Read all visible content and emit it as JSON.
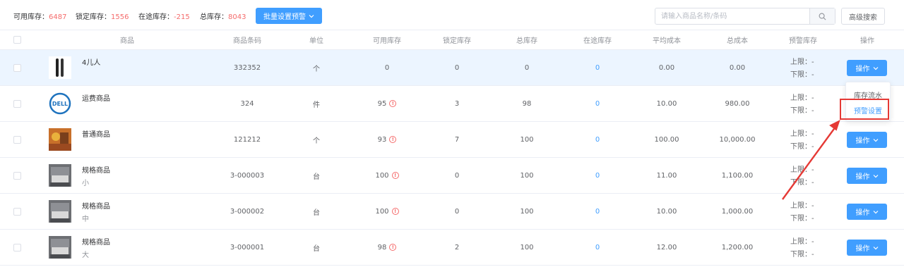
{
  "stats": {
    "available_label": "可用库存：",
    "available_value": "6487",
    "locked_label": "锁定库存：",
    "locked_value": "1556",
    "intransit_label": "在途库存：",
    "intransit_value": "-215",
    "total_label": "总库存：",
    "total_value": "8043"
  },
  "toolbar": {
    "batch_label": "批量设置预警",
    "search_placeholder": "请输入商品名称/条码",
    "advanced_label": "高级搜索"
  },
  "columns": [
    "商品",
    "商品条码",
    "单位",
    "可用库存",
    "锁定库存",
    "总库存",
    "在途库存",
    "平均成本",
    "总成本",
    "预警库存",
    "操作"
  ],
  "rows": [
    {
      "name": "4儿人",
      "sub": "",
      "barcode": "332352",
      "unit": "个",
      "available": "0",
      "warn": false,
      "locked": "0",
      "total": "0",
      "intransit": "0",
      "avg_cost": "0.00",
      "total_cost": "0.00",
      "upper": "上限：-",
      "lower": "下限：-",
      "thumb": "comb"
    },
    {
      "name": "运费商品",
      "sub": "",
      "barcode": "324",
      "unit": "件",
      "available": "95",
      "warn": true,
      "locked": "3",
      "total": "98",
      "intransit": "0",
      "avg_cost": "10.00",
      "total_cost": "980.00",
      "upper": "上限：-",
      "lower": "下限：-",
      "thumb": "dell"
    },
    {
      "name": "普通商品",
      "sub": "",
      "barcode": "121212",
      "unit": "个",
      "available": "93",
      "warn": true,
      "locked": "7",
      "total": "100",
      "intransit": "0",
      "avg_cost": "100.00",
      "total_cost": "10,000.00",
      "upper": "上限：-",
      "lower": "下限：-",
      "thumb": "photo"
    },
    {
      "name": "规格商品",
      "sub": "小",
      "barcode": "3-000003",
      "unit": "台",
      "available": "100",
      "warn": true,
      "locked": "0",
      "total": "100",
      "intransit": "0",
      "avg_cost": "11.00",
      "total_cost": "1,100.00",
      "upper": "上限：-",
      "lower": "下限：-",
      "thumb": "room"
    },
    {
      "name": "规格商品",
      "sub": "中",
      "barcode": "3-000002",
      "unit": "台",
      "available": "100",
      "warn": true,
      "locked": "0",
      "total": "100",
      "intransit": "0",
      "avg_cost": "10.00",
      "total_cost": "1,000.00",
      "upper": "上限：-",
      "lower": "下限：-",
      "thumb": "room"
    },
    {
      "name": "规格商品",
      "sub": "大",
      "barcode": "3-000001",
      "unit": "台",
      "available": "98",
      "warn": true,
      "locked": "2",
      "total": "100",
      "intransit": "0",
      "avg_cost": "12.00",
      "total_cost": "1,200.00",
      "upper": "上限：-",
      "lower": "下限：-",
      "thumb": "room"
    }
  ],
  "op_label": "操作",
  "dropdown": {
    "items": [
      "库存流水",
      "预警设置"
    ]
  },
  "thumb_text": {
    "dell": "DELL"
  },
  "colors": {
    "accent": "#409eff",
    "danger": "#f56c6c",
    "annotation": "#e53935",
    "highlight_row": "#ecf5ff"
  }
}
